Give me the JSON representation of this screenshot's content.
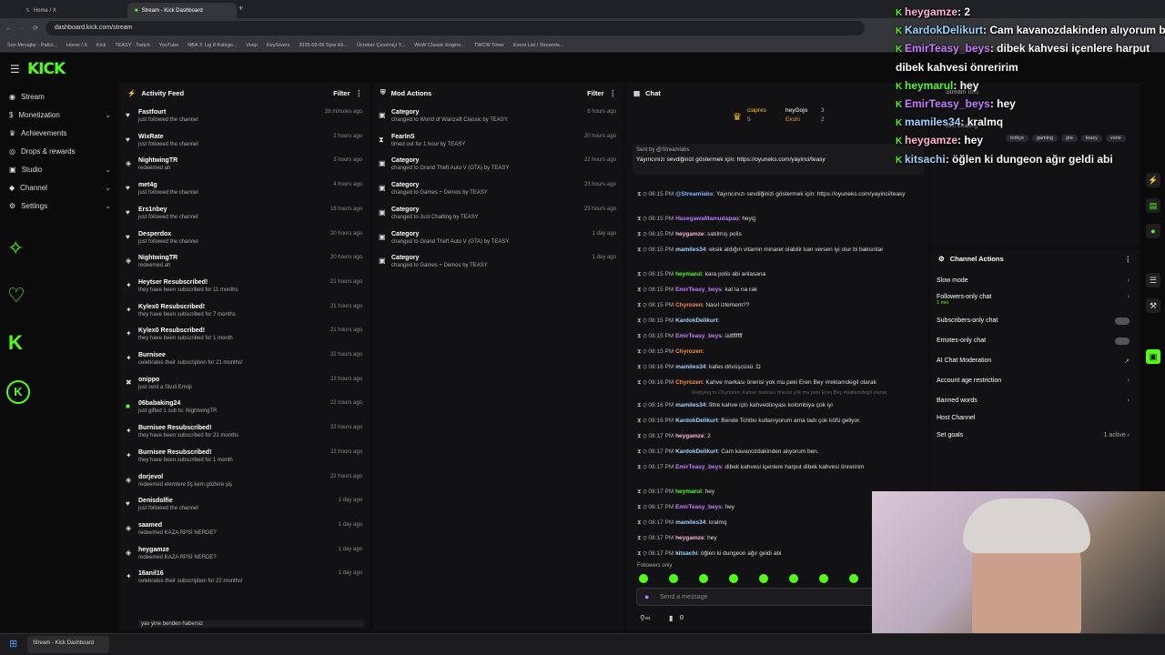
{
  "browser": {
    "tabs": [
      {
        "label": "Home / X"
      },
      {
        "label": "Stream - Kick Dashboard"
      }
    ],
    "url": "dashboard.kick.com/stream",
    "bookmarks": [
      "Son Mesajlar - Patici...",
      "Home / X",
      "Kick",
      "TEASY - Twitch",
      "YouTube",
      "NBA 3. Lig 8 Katego...",
      "Voep",
      "KeyGivers",
      "2025-09-06 Spor Ek...",
      "Ücretsiz Çevrimiçi Y...",
      "WoW Classic Engine...",
      "TWCW Timer",
      "Event List / Streamla..."
    ]
  },
  "brand": {
    "logo": "KICK",
    "accent": "#53fc18"
  },
  "sidebar": {
    "items": [
      {
        "label": "Stream",
        "icon": "broadcast-icon"
      },
      {
        "label": "Monetization",
        "icon": "dollar-icon"
      },
      {
        "label": "Achievements",
        "icon": "trophy-icon"
      },
      {
        "label": "Drops & rewards",
        "icon": "gift-icon"
      },
      {
        "label": "Studio",
        "icon": "video-icon"
      },
      {
        "label": "Channel",
        "icon": "user-icon"
      },
      {
        "label": "Settings",
        "icon": "gear-icon"
      }
    ]
  },
  "activity": {
    "title": "Activity Feed",
    "filter": "Filter",
    "items": [
      {
        "name": "Fastfourt",
        "sub": "just followed the channel",
        "time": "28 minutes ago",
        "icon": "heart-icon"
      },
      {
        "name": "WixRate",
        "sub": "just followed the channel",
        "time": "2 hours ago",
        "icon": "heart-icon"
      },
      {
        "name": "NightwingTR",
        "sub": "redeemed ah",
        "time": "3 hours ago",
        "icon": "reward-icon"
      },
      {
        "name": "met4g",
        "sub": "just followed the channel",
        "time": "4 hours ago",
        "icon": "heart-icon"
      },
      {
        "name": "Ers1nbey",
        "sub": "just followed the channel",
        "time": "18 hours ago",
        "icon": "heart-icon"
      },
      {
        "name": "Desperdox",
        "sub": "just followed the channel",
        "time": "20 hours ago",
        "icon": "heart-icon"
      },
      {
        "name": "NightwingTR",
        "sub": "redeemed ah",
        "time": "20 hours ago",
        "icon": "reward-icon"
      },
      {
        "name": "Heytser Resubscribed!",
        "sub": "they have been subscribed for 11 months",
        "time": "21 hours ago",
        "icon": "star-icon"
      },
      {
        "name": "Kylex0 Resubscribed!",
        "sub": "they have been subscribed for 7 months",
        "time": "21 hours ago",
        "icon": "star-icon"
      },
      {
        "name": "Kylex0 Resubscribed!",
        "sub": "they have been subscribed for 1 month",
        "time": "21 hours ago",
        "icon": "star-icon"
      },
      {
        "name": "Burnisee",
        "sub": "celebrates their subscription for 21 months!",
        "time": "22 hours ago",
        "icon": "star-icon"
      },
      {
        "name": "onippo",
        "sub": "just sent a Skull Emoji",
        "time": "22 hours ago",
        "icon": "kick-icon"
      },
      {
        "name": "06babaking24",
        "sub": "just gifted 1 sub to: NightwingTR",
        "time": "22 hours ago",
        "icon": "gift-icon"
      },
      {
        "name": "Burnisee Resubscribed!",
        "sub": "they have been subscribed for 21 months",
        "time": "22 hours ago",
        "icon": "star-icon"
      },
      {
        "name": "Burnisee Resubscribed!",
        "sub": "they have been subscribed for 1 month",
        "time": "22 hours ago",
        "icon": "star-icon"
      },
      {
        "name": "dorjevol",
        "sub": "redeemed elemtere fiş kem gözlere şiş",
        "time": "22 hours ago",
        "icon": "reward-icon"
      },
      {
        "name": "Denisdolfie",
        "sub": "just followed the channel",
        "time": "1 day ago",
        "icon": "heart-icon"
      },
      {
        "name": "saamed",
        "sub": "redeemed KAZA RPSİ NERDE?",
        "time": "1 day ago",
        "icon": "reward-icon"
      },
      {
        "name": "heygamze",
        "sub": "redeemed KAZA RPSİ NERDE?",
        "time": "1 day ago",
        "icon": "reward-icon"
      },
      {
        "name": "16anil16",
        "sub": "celebrates their subscription for 22 months!",
        "time": "1 day ago",
        "icon": "star-icon"
      }
    ],
    "note": "yav yine benden habersiz"
  },
  "mod": {
    "title": "Mod Actions",
    "filter": "Filter",
    "items": [
      {
        "name": "Category",
        "sub": "changed to World of Warcraft Classic by TEASY",
        "time": "8 hours ago"
      },
      {
        "name": "FearInS",
        "sub": "timed out for 1 hour by TEASY",
        "time": "20 hours ago"
      },
      {
        "name": "Category",
        "sub": "changed to Grand Theft Auto V (GTA) by TEASY",
        "time": "22 hours ago"
      },
      {
        "name": "Category",
        "sub": "changed to Games + Demos by TEASY",
        "time": "23 hours ago"
      },
      {
        "name": "Category",
        "sub": "changed to Just Chatting by TEASY",
        "time": "23 hours ago"
      },
      {
        "name": "Category",
        "sub": "changed to Grand Theft Auto V (GTA) by TEASY",
        "time": "1 day ago"
      },
      {
        "name": "Category",
        "sub": "changed to Games + Demos by TEASY",
        "time": "1 day ago"
      }
    ]
  },
  "chat": {
    "title": "Chat",
    "leaders": [
      {
        "name": "ciapres",
        "val": "5"
      },
      {
        "name": "heyGojo",
        "val": "3"
      },
      {
        "name": "Ekshi",
        "val": "2"
      }
    ],
    "pinned_by": "Sent by @Streamlabs",
    "pinned": "Yayıncınızı sevdiğinizi göstermek için: https://oyuneks.com/yayinci/teasy",
    "messages": [
      {
        "time": "08:15 PM",
        "user": "@Streamlabs",
        "color": "#7ab7ff",
        "text": "Yayıncınızı sevdiğinizi göstermek için: https://oyuneks.com/yayinci/teasy"
      },
      {
        "time": "08:15 PM",
        "user": "HasegawaMamudapao",
        "color": "#b57dff",
        "text": "heyçj"
      },
      {
        "time": "08:15 PM",
        "user": "heygamze",
        "color": "#ffb2d0",
        "text": "satılmış polis"
      },
      {
        "time": "08:15 PM",
        "user": "mamiles34",
        "color": "#9fd4ff",
        "text": "eksik aldığın vitamin minarel olabilir kan versen iyi olur bi baksınlar"
      },
      {
        "time": "08:15 PM",
        "user": "heymarul",
        "color": "#53fc18",
        "text": "kara polis abi anlasana"
      },
      {
        "time": "08:15 PM",
        "user": "EmirTeasy_beys",
        "color": "#c77dff",
        "text": "kat la na rak"
      },
      {
        "time": "08:15 PM",
        "user": "Chyrozen",
        "color": "#ff8c42",
        "text": "Nasıl izlemem??"
      },
      {
        "time": "08:15 PM",
        "user": "KardokDelikurt",
        "color": "#9fd4ff",
        "text": ""
      },
      {
        "time": "08:15 PM",
        "user": "EmirTeasy_beys",
        "color": "#c77dff",
        "text": "üdfffffff"
      },
      {
        "time": "08:15 PM",
        "user": "Chyrozen",
        "color": "#ff8c42",
        "text": ""
      },
      {
        "time": "08:16 PM",
        "user": "mamiles34",
        "color": "#9fd4ff",
        "text": "kafes dövüşcüsü :D"
      },
      {
        "time": "08:16 PM",
        "user": "Chyrozen",
        "color": "#ff8c42",
        "text": "Kahve markası önerisi yok mu peki Eren Bey #reklamdegil olarak"
      },
      {
        "time": "08:16 PM",
        "user": "mamiles34",
        "color": "#9fd4ff",
        "text": "filtre kahve için kahvedünyası kolombiya çok iyi"
      },
      {
        "time": "08:16 PM",
        "user": "KardokDelikurt",
        "color": "#9fd4ff",
        "text": "Bende Tchibo kullanıyorum ama tadı çok köfü geliyor."
      },
      {
        "time": "08:17 PM",
        "user": "heygamze",
        "color": "#ffb2d0",
        "text": "2"
      },
      {
        "time": "08:17 PM",
        "user": "KardokDelikurt",
        "color": "#9fd4ff",
        "text": "Cam kavanozdakinden alıyorum ben."
      },
      {
        "time": "08:17 PM",
        "user": "EmirTeasy_beys",
        "color": "#c77dff",
        "text": "dibek kahvesi içenlere harput dibek kahvesi önreririm"
      },
      {
        "time": "08:17 PM",
        "user": "heymarul",
        "color": "#53fc18",
        "text": "hey"
      },
      {
        "time": "08:17 PM",
        "user": "EmirTeasy_beys",
        "color": "#c77dff",
        "text": "hey"
      },
      {
        "time": "08:17 PM",
        "user": "mamiles34",
        "color": "#9fd4ff",
        "text": "kralmq"
      },
      {
        "time": "08:17 PM",
        "user": "heygamze",
        "color": "#ffb2d0",
        "text": "hey"
      },
      {
        "time": "08:17 PM",
        "user": "kitsachi",
        "color": "#9fd4ff",
        "text": "öğlen ki dungeon ağır geldi abi"
      }
    ],
    "reply_hint": "Replying to Chyrozen: Kahve markası önerisi yok mu peki Eren Bey #reklamdegil olarak",
    "followers_only": "Followers only",
    "input_placeholder": "Send a message",
    "viewer_count": "0"
  },
  "overlay": [
    {
      "user": "heygamze",
      "text": ": 2",
      "color": "#ffb2d0"
    },
    {
      "user": "KardokDelikurt",
      "text": ": Cam kavanozdakinden alıyorum ben.",
      "color": "#9fd4ff"
    },
    {
      "user": "EmirTeasy_beys",
      "text": ": dibek kahvesi içenlere harput",
      "color": "#c77dff"
    },
    {
      "user": "",
      "text": "dibek kahvesi önreririm",
      "color": "#fff"
    },
    {
      "user": "heymarul",
      "text": ": hey",
      "color": "#53fc18"
    },
    {
      "user": "EmirTeasy_beys",
      "text": ": hey",
      "color": "#c77dff"
    },
    {
      "user": "mamiles34",
      "text": ": kralmq",
      "color": "#9fd4ff"
    },
    {
      "user": "heygamze",
      "text": ": hey",
      "color": "#ffb2d0"
    },
    {
      "user": "kitsachi",
      "text": ": öğlen ki dungeon ağır geldi abi",
      "color": "#9fd4ff"
    }
  ],
  "streaminfo": {
    "title": "Stream Info",
    "category": "Just Chatting",
    "tags": [
      "türkçe",
      "gaming",
      "gta",
      "teasy",
      "varie"
    ]
  },
  "channel_actions": {
    "title": "Channel Actions",
    "items": [
      {
        "label": "Slow mode",
        "right": "›"
      },
      {
        "label": "Followers-only chat",
        "sub": "1 min",
        "right": "›"
      },
      {
        "label": "Subscribers-only chat",
        "right": "toggle"
      },
      {
        "label": "Emotes-only chat",
        "right": "toggle"
      },
      {
        "label": "AI Chat Moderation",
        "right": "↗"
      },
      {
        "label": "Account age restriction",
        "right": "›"
      },
      {
        "label": "Banned words",
        "right": "›"
      },
      {
        "label": "Host Channel",
        "right": ""
      },
      {
        "label": "Set goals",
        "right": "1 active ›"
      }
    ]
  },
  "taskbar": {
    "app": "Stream - Kick Dashboard"
  }
}
